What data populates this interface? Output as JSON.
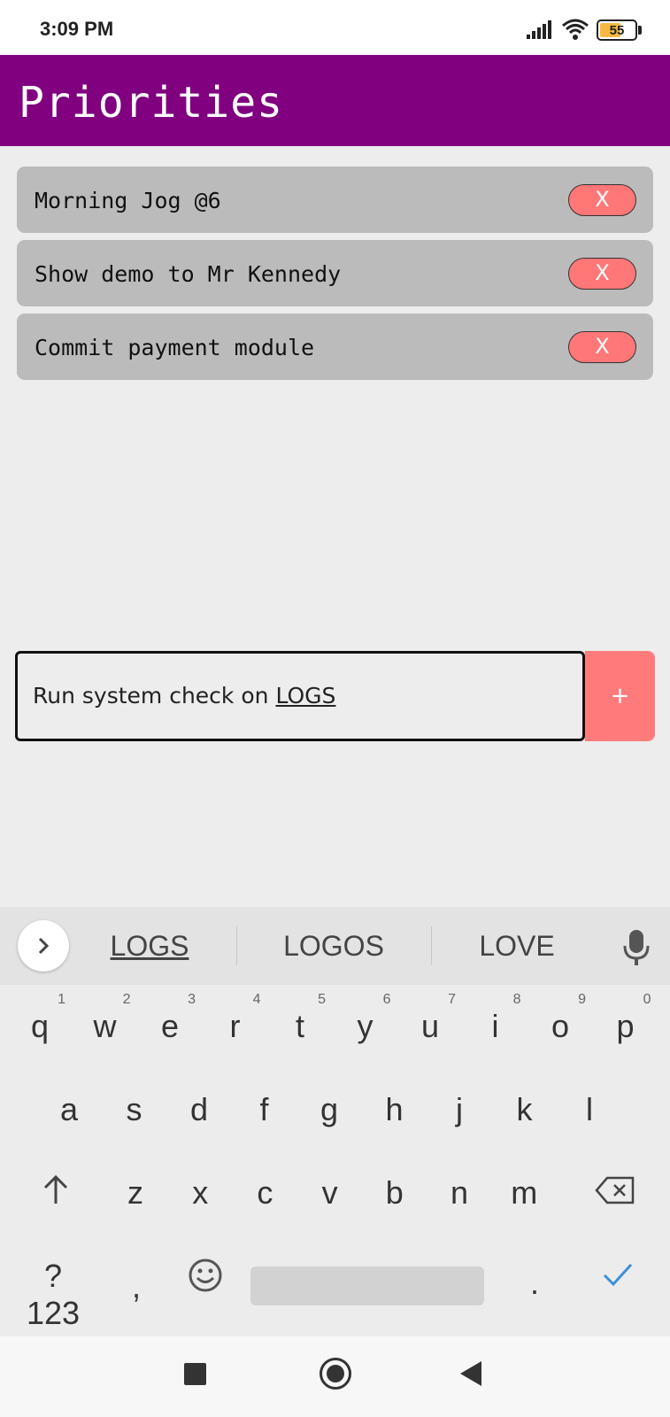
{
  "status_bar": {
    "time": "3:09 PM",
    "battery_level": "55",
    "icons": [
      "signal-icon",
      "wifi-icon",
      "battery-icon"
    ]
  },
  "app": {
    "title": "Priorities",
    "header_color": "#800080"
  },
  "tasks": [
    {
      "text": "Morning Jog @6",
      "delete_label": "X"
    },
    {
      "text": "Show demo to Mr Kennedy",
      "delete_label": "X"
    },
    {
      "text": "Commit payment module",
      "delete_label": "X"
    }
  ],
  "input": {
    "value_prefix": "Run system check on ",
    "value_composing": "LOGS",
    "add_label": "+"
  },
  "keyboard": {
    "suggestions": [
      "LOGS",
      "LOGOS",
      "LOVE"
    ],
    "row1": [
      {
        "key": "q",
        "hint": "1"
      },
      {
        "key": "w",
        "hint": "2"
      },
      {
        "key": "e",
        "hint": "3"
      },
      {
        "key": "r",
        "hint": "4"
      },
      {
        "key": "t",
        "hint": "5"
      },
      {
        "key": "y",
        "hint": "6"
      },
      {
        "key": "u",
        "hint": "7"
      },
      {
        "key": "i",
        "hint": "8"
      },
      {
        "key": "o",
        "hint": "9"
      },
      {
        "key": "p",
        "hint": "0"
      }
    ],
    "row2": [
      "a",
      "s",
      "d",
      "f",
      "g",
      "h",
      "j",
      "k",
      "l"
    ],
    "row3": [
      "z",
      "x",
      "c",
      "v",
      "b",
      "n",
      "m"
    ],
    "symbols_label": "?123",
    "comma_label": ",",
    "period_label": "."
  },
  "colors": {
    "accent": "#ff7b7b",
    "task_background": "#bbbbbb",
    "check_color": "#3b8fd9"
  },
  "nav": {
    "icons": [
      "recents-icon",
      "home-icon",
      "back-icon"
    ]
  }
}
